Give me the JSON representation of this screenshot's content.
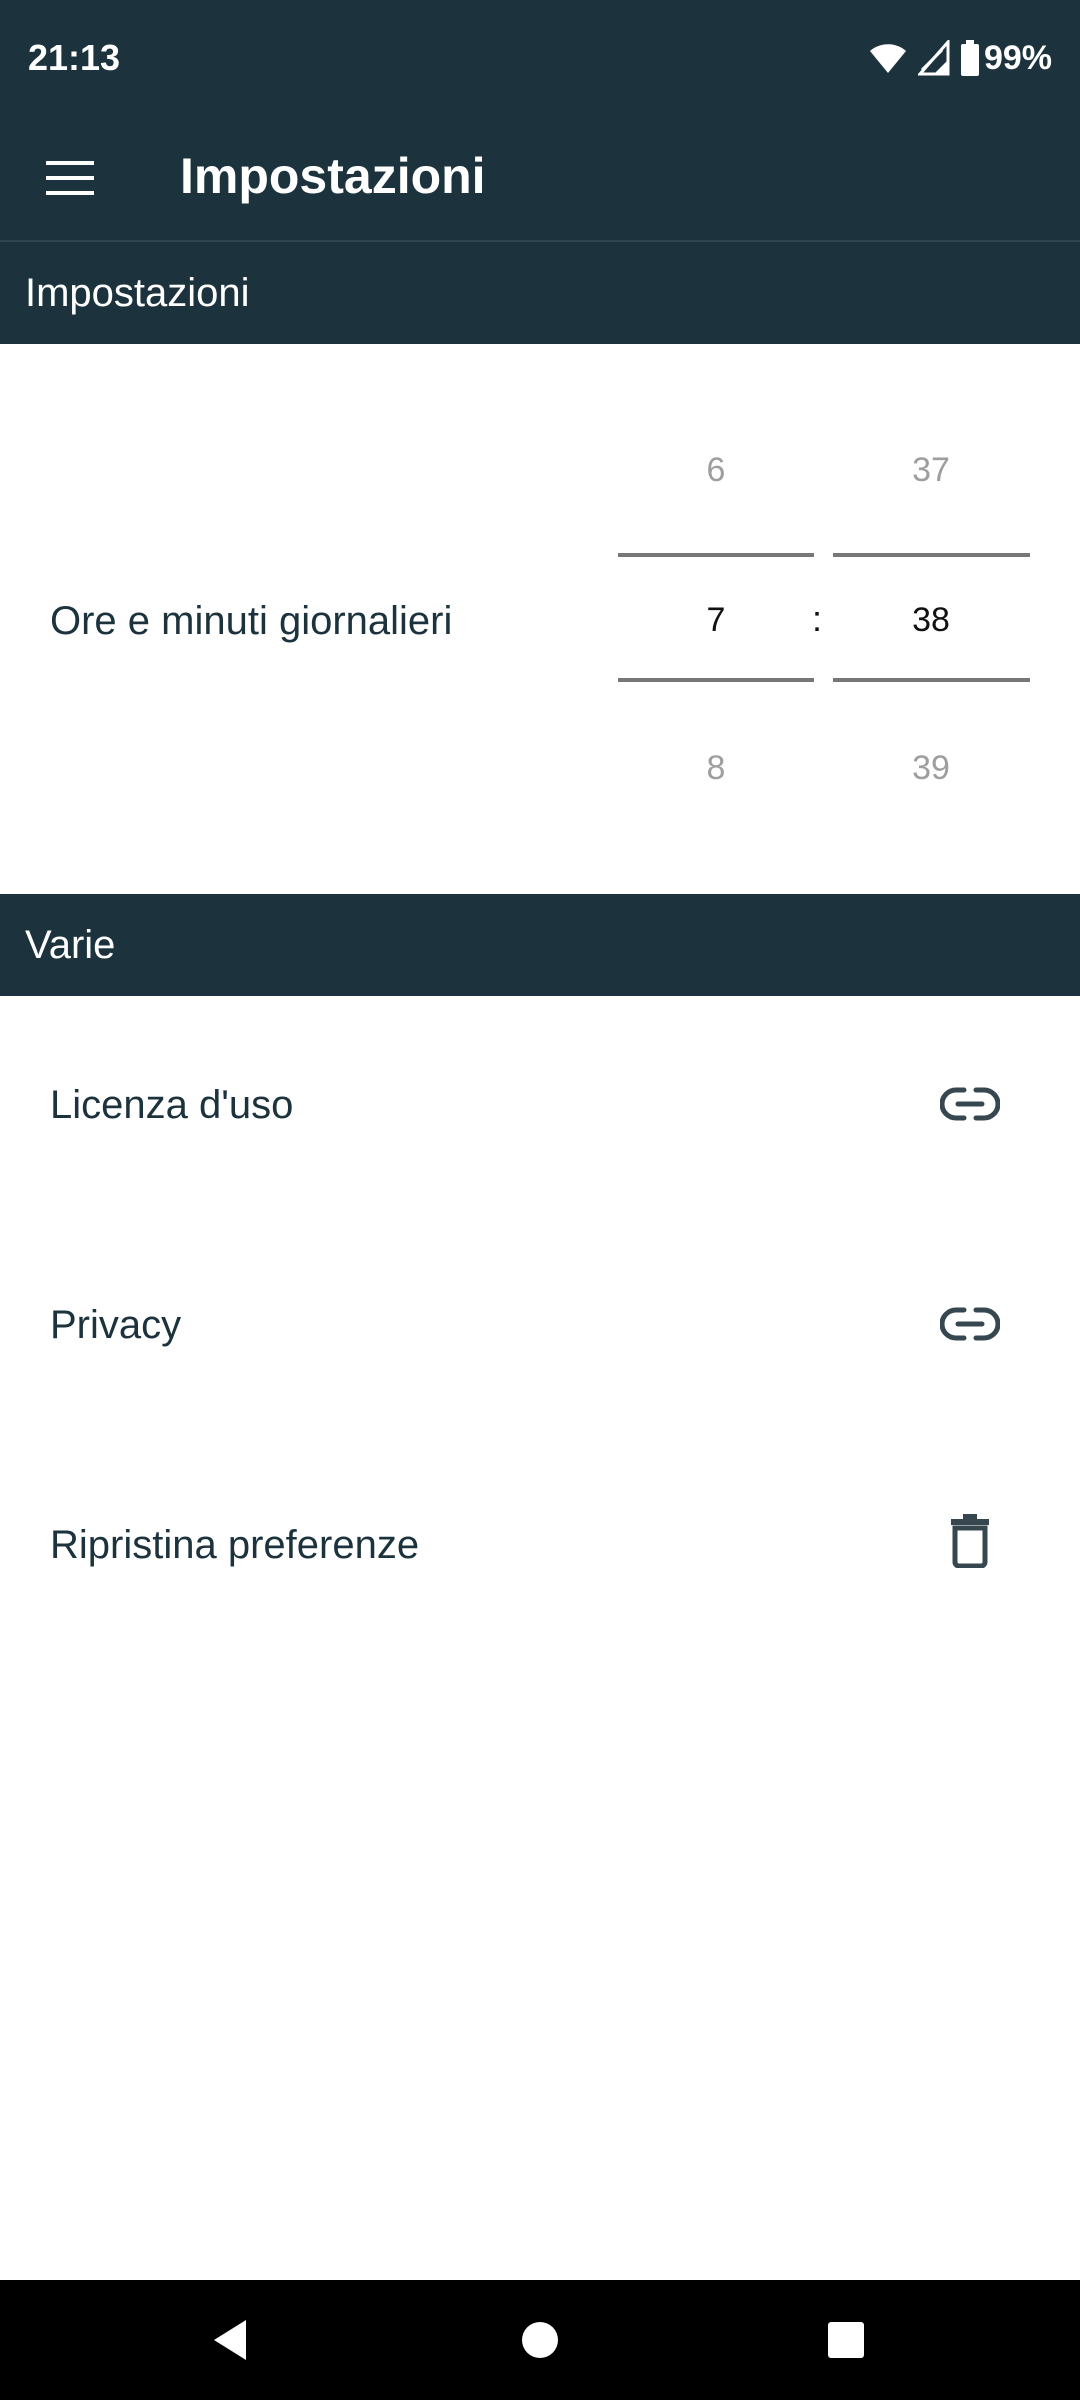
{
  "status_bar": {
    "time": "21:13",
    "battery": "99%",
    "icons": [
      "wifi-icon",
      "signal-icon",
      "battery-icon"
    ]
  },
  "app_bar": {
    "title": "Impostazioni",
    "menu_icon": "hamburger-menu-icon"
  },
  "sections": {
    "settings_header": "Impostazioni",
    "misc_header": "Varie"
  },
  "time_picker": {
    "label": "Ore e minuti giornalieri",
    "hours": {
      "prev": "6",
      "selected": "7",
      "next": "8"
    },
    "minutes": {
      "prev": "37",
      "selected": "38",
      "next": "39"
    },
    "separator": ":"
  },
  "misc_items": [
    {
      "label": "Licenza d'uso",
      "icon": "link-icon"
    },
    {
      "label": "Privacy",
      "icon": "link-icon"
    },
    {
      "label": "Ripristina preferenze",
      "icon": "trash-icon"
    }
  ],
  "nav_bar": {
    "buttons": [
      "back-icon",
      "home-icon",
      "recents-icon"
    ]
  },
  "colors": {
    "primary_dark": "#1c333d",
    "text_dim": "#9e9e9e",
    "background": "#ffffff"
  }
}
